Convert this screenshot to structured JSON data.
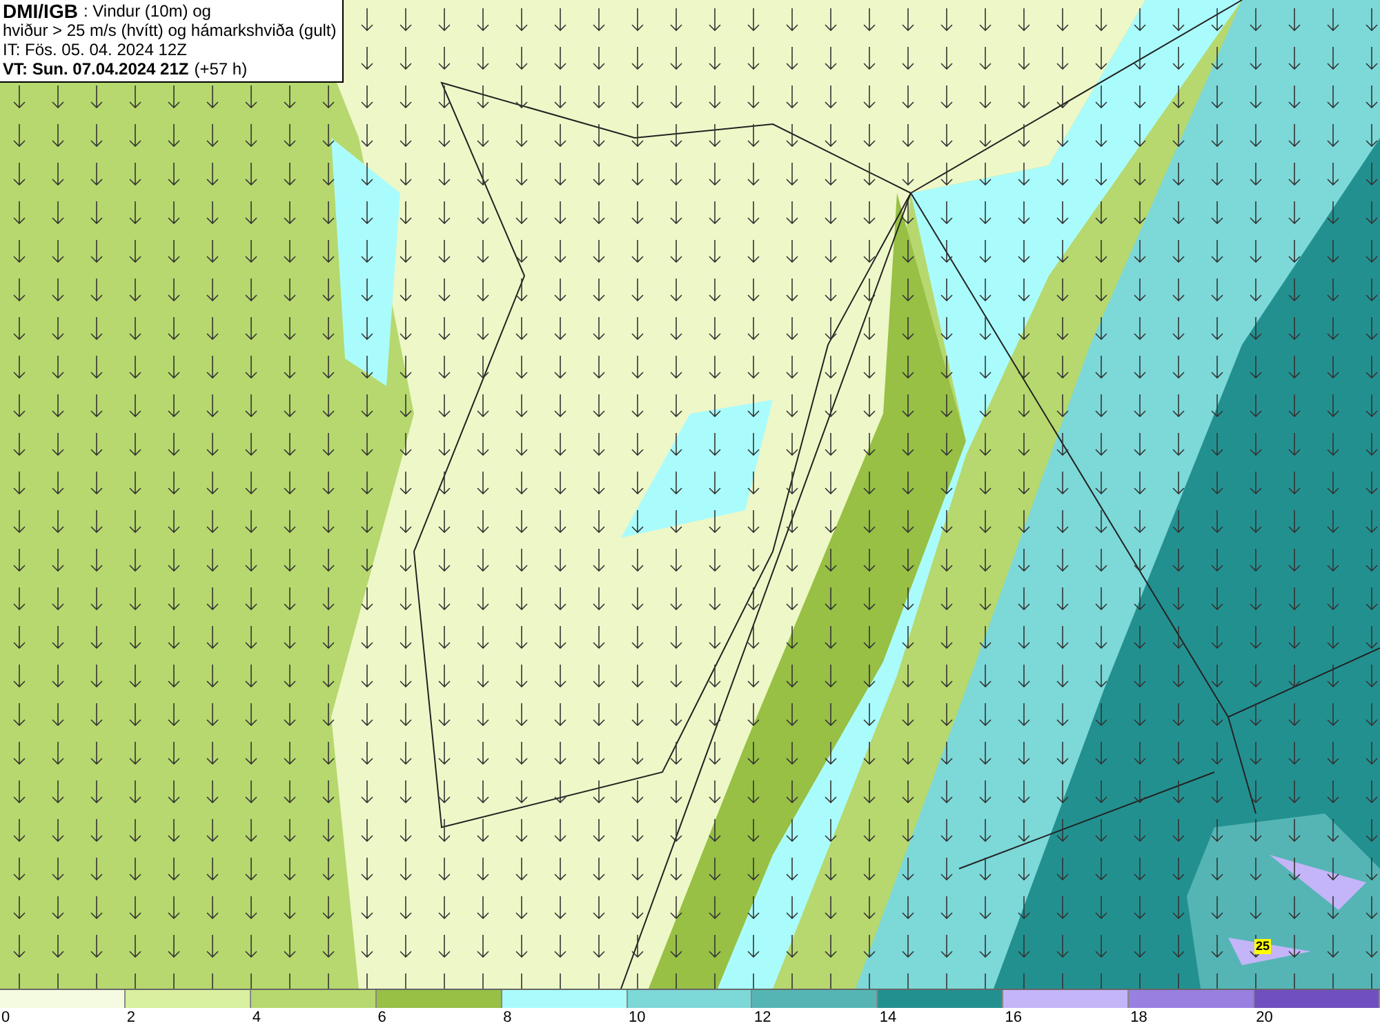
{
  "header": {
    "title": "DMI/IGB",
    "title_rest": ": Vindur (10m) og",
    "line_2": "hviður > 25 m/s (hvítt) og hámarkshviða (gult)",
    "line_3": "IT: Fös. 05. 04. 2024 12Z",
    "valid_time": "VT: Sun. 07.04.2024 21Z",
    "lead": "(+57 h)"
  },
  "map": {
    "gust_label": "25"
  },
  "legend": {
    "bins": [
      {
        "color": "#f4fbe0"
      },
      {
        "color": "#d8f0a0"
      },
      {
        "color": "#b6d86e"
      },
      {
        "color": "#97c045"
      },
      {
        "color": "#aafcfc"
      },
      {
        "color": "#7dd8d8"
      },
      {
        "color": "#55b5b5"
      },
      {
        "color": "#239090"
      },
      {
        "color": "#c4b4f8"
      },
      {
        "color": "#9880e0"
      },
      {
        "color": "#7050c0"
      }
    ],
    "ticks": [
      "0",
      "2",
      "4",
      "6",
      "8",
      "10",
      "12",
      "14",
      "16",
      "18",
      "20"
    ]
  }
}
